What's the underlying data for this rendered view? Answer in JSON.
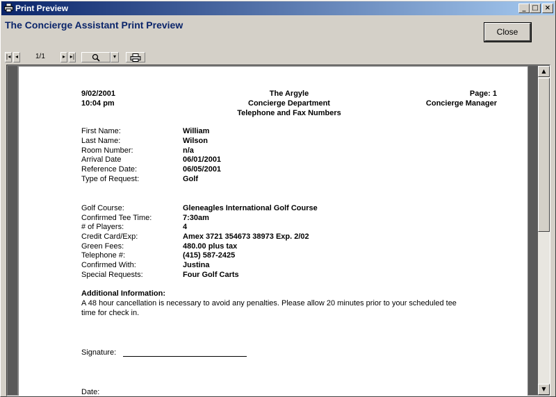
{
  "window": {
    "title": "Print Preview"
  },
  "app": {
    "title": "The Concierge Assistant Print Preview",
    "close_label": "Close"
  },
  "toolbar": {
    "page_indicator": "1/1",
    "zoom_icon": "magnifier-icon",
    "print_icon": "printer-icon"
  },
  "report": {
    "date": "9/02/2001",
    "time": "10:04 pm",
    "hotel": "The Argyle",
    "department": "Concierge Department",
    "subtitle": "Telephone and Fax Numbers",
    "page": "Page: 1",
    "role": "Concierge Manager",
    "fields1": [
      {
        "label": "First Name:",
        "value": "William"
      },
      {
        "label": "Last Name:",
        "value": "Wilson"
      },
      {
        "label": "Room Number:",
        "value": "n/a"
      },
      {
        "label": "Arrival Date",
        "value": "06/01/2001"
      },
      {
        "label": "Reference Date:",
        "value": "06/05/2001"
      },
      {
        "label": "Type of Request:",
        "value": "Golf"
      }
    ],
    "fields2": [
      {
        "label": "Golf Course:",
        "value": "Gleneagles International Golf Course"
      },
      {
        "label": "Confirmed Tee Time:",
        "value": "7:30am"
      },
      {
        "label": "# of Players:",
        "value": "4"
      },
      {
        "label": "Credit Card/Exp:",
        "value": "Amex  3721 354673 38973  Exp. 2/02"
      },
      {
        "label": "Green Fees:",
        "value": "480.00  plus tax"
      },
      {
        "label": "Telephone #:",
        "value": "(415) 587-2425"
      },
      {
        "label": "Confirmed With:",
        "value": "Justina"
      },
      {
        "label": "Special Requests:",
        "value": "Four Golf Carts"
      }
    ],
    "additional_heading": "Additional Information:",
    "additional_line1": "A 48 hour cancellation is necessary to avoid any penalties. Please allow 20 minutes prior to your scheduled tee",
    "additional_line2": "time for check in.",
    "signature_label": "Signature:",
    "date_label": "Date:"
  }
}
